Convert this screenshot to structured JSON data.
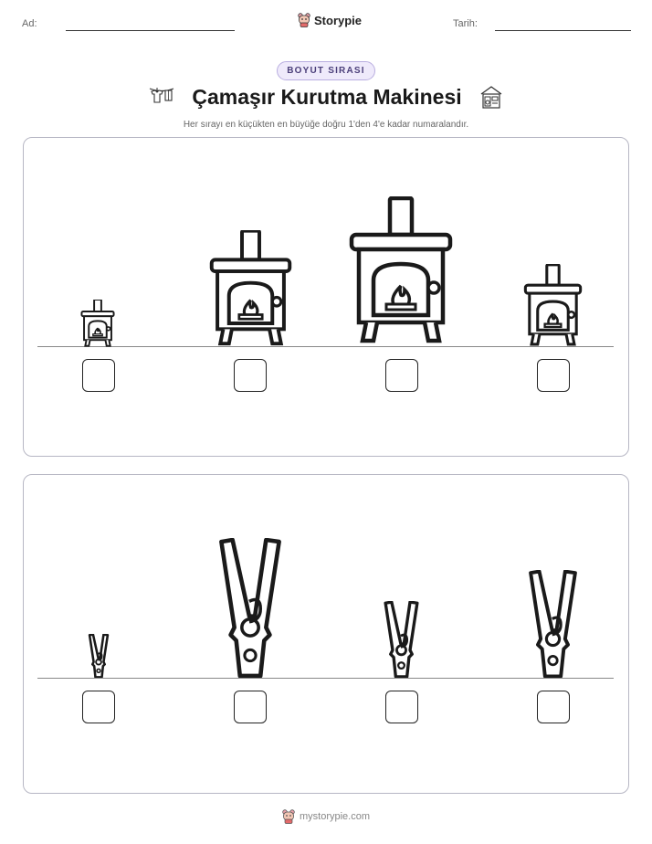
{
  "header": {
    "name_label": "Ad:",
    "date_label": "Tarih:",
    "brand_name": "Storypie"
  },
  "worksheet": {
    "badge": "BOYUT SIRASI",
    "title": "Çamaşır Kurutma Makinesi",
    "instructions": "Her sırayı en küçükten en büyüğe doğru 1'den 4'e kadar numaralandır.",
    "title_icons": [
      "clothesline-icon",
      "laundry-room-icon"
    ]
  },
  "rows": [
    {
      "item": "stove-icon",
      "relative_sizes": [
        0.22,
        0.78,
        1.0,
        0.56
      ],
      "answers": [
        "",
        "",
        "",
        ""
      ]
    },
    {
      "item": "clothespin-icon",
      "relative_sizes": [
        0.31,
        1.0,
        0.54,
        0.77
      ],
      "answers": [
        "",
        "",
        "",
        ""
      ]
    }
  ],
  "footer": {
    "site": "mystorypie.com"
  }
}
